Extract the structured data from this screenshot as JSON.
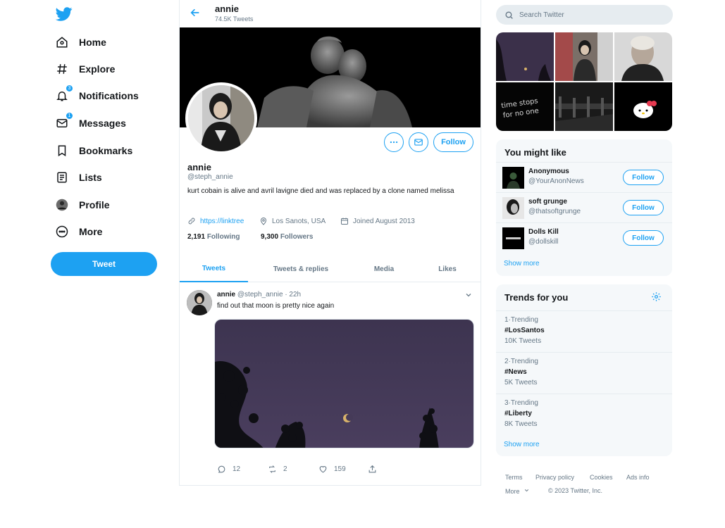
{
  "colors": {
    "accent": "#1da1f2",
    "text": "#14171a",
    "muted": "#657786",
    "border": "#e6ecf0",
    "panel": "#f5f8fa"
  },
  "nav": {
    "logo_icon": "twitter-bird-icon",
    "items": [
      {
        "label": "Home",
        "icon": "home-icon"
      },
      {
        "label": "Explore",
        "icon": "hashtag-icon"
      },
      {
        "label": "Notifications",
        "icon": "bell-icon",
        "badge": "3"
      },
      {
        "label": "Messages",
        "icon": "envelope-icon",
        "badge": "1"
      },
      {
        "label": "Bookmarks",
        "icon": "bookmark-icon"
      },
      {
        "label": "Lists",
        "icon": "list-icon"
      },
      {
        "label": "Profile",
        "icon": "avatar-icon"
      },
      {
        "label": "More",
        "icon": "more-circle-icon"
      }
    ],
    "tweet_button": "Tweet"
  },
  "header": {
    "name": "annie",
    "tweet_count": "74.5K Tweets"
  },
  "profile": {
    "name": "annie",
    "handle": "@steph_annie",
    "bio": "kurt cobain is alive and avril lavigne died and was replaced by a clone named melissa",
    "link": "https://linktree",
    "location": "Los Sanots, USA",
    "joined": "Joined August 2013",
    "following_count": "2,191",
    "following_label": "Following",
    "followers_count": "9,300",
    "followers_label": "Followers",
    "follow_button": "Follow"
  },
  "tabs": [
    {
      "label": "Tweets",
      "active": true
    },
    {
      "label": "Tweets & replies"
    },
    {
      "label": "Media"
    },
    {
      "label": "Likes"
    }
  ],
  "tweet": {
    "name": "annie",
    "handle_time": "@steph_annie · 22h",
    "text": "find out that moon is pretty nice again",
    "replies": "12",
    "retweets": "2",
    "likes": "159"
  },
  "search": {
    "placeholder": "Search Twitter"
  },
  "gallery": {
    "caption_text": "time stops for no one"
  },
  "you_might_like": {
    "title": "You might like",
    "users": [
      {
        "name": "Anonymous",
        "handle": "@YourAnonNews",
        "button": "Follow"
      },
      {
        "name": "soft grunge",
        "handle": "@thatsoftgrunge",
        "button": "Follow"
      },
      {
        "name": "Dolls Kill",
        "handle": "@dollskill",
        "button": "Follow"
      }
    ],
    "show_more": "Show more"
  },
  "trends": {
    "title": "Trends for you",
    "items": [
      {
        "meta": "1·Trending",
        "tag": "#LosSantos",
        "count": "10K Tweets"
      },
      {
        "meta": "2·Trending",
        "tag": "#News",
        "count": "5K Tweets"
      },
      {
        "meta": "3·Trending",
        "tag": "#Liberty",
        "count": "8K Tweets"
      }
    ],
    "show_more": "Show more"
  },
  "footer": {
    "terms": "Terms",
    "privacy": "Privacy policy",
    "cookies": "Cookies",
    "ads": "Ads info",
    "more": "More",
    "copyright": "© 2023 Twitter, Inc."
  }
}
